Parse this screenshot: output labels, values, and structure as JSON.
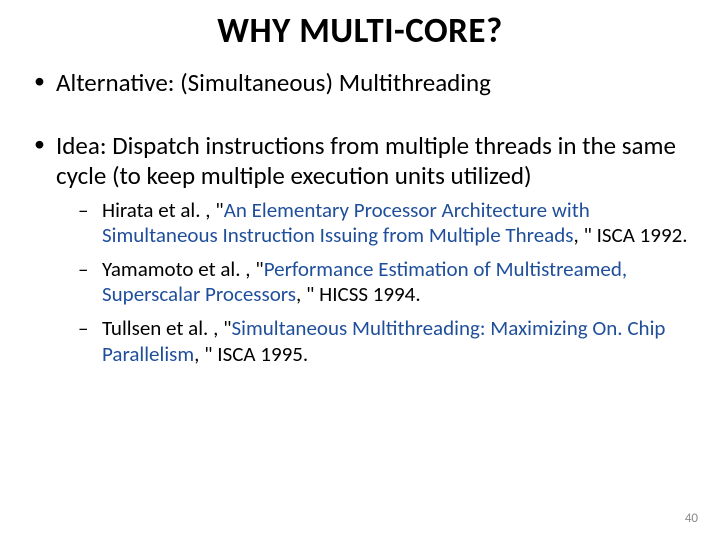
{
  "title": "WHY MULTI-CORE?",
  "bullets": {
    "alt": "Alternative: (Simultaneous) Multithreading",
    "idea_label": "Idea:",
    "idea_rest": " Dispatch instructions from multiple threads in the same cycle (to keep multiple execution units utilized)"
  },
  "refs": [
    {
      "pre": "Hirata et al. , \"",
      "link": "An Elementary Processor Architecture with Simultaneous Instruction Issuing from Multiple Threads",
      "post": ", \" ISCA 1992."
    },
    {
      "pre": "Yamamoto et al. , \"",
      "link": "Performance Estimation of Multistreamed, Superscalar Processors",
      "post": ", \" HICSS 1994."
    },
    {
      "pre": "Tullsen et al. , \"",
      "link": "Simultaneous Multithreading: Maximizing On. Chip Parallelism",
      "post": ", \" ISCA 1995."
    }
  ],
  "page": "40"
}
